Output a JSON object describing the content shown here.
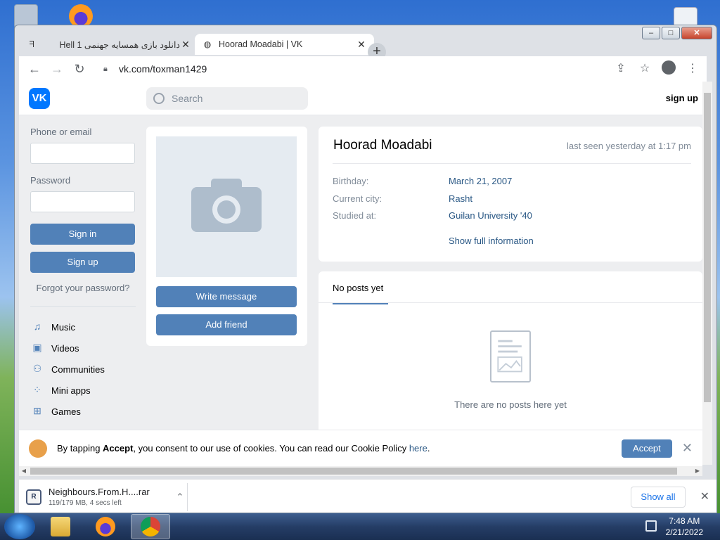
{
  "browser": {
    "tabs": [
      {
        "title": "دانلود بازی همسایه جهنمی Hell 1"
      },
      {
        "title": "Hoorad Moadabi | VK"
      }
    ],
    "url": "vk.com/toxman1429"
  },
  "vk": {
    "search_placeholder": "Search",
    "signup_link": "sign up",
    "login": {
      "phone_label": "Phone or email",
      "password_label": "Password",
      "signin_label": "Sign in",
      "signup_label": "Sign up",
      "forgot_label": "Forgot your password?"
    },
    "menu": [
      {
        "label": "Music",
        "icon": "music-icon"
      },
      {
        "label": "Videos",
        "icon": "video-icon"
      },
      {
        "label": "Communities",
        "icon": "communities-icon"
      },
      {
        "label": "Mini apps",
        "icon": "mini-apps-icon"
      },
      {
        "label": "Games",
        "icon": "gamepad-icon"
      }
    ],
    "profile": {
      "write_message": "Write message",
      "add_friend": "Add friend",
      "name": "Hoorad Moadabi",
      "last_seen": "last seen yesterday at 1:17 pm",
      "fields": [
        {
          "key": "Birthday:",
          "value": "March 21, 2007"
        },
        {
          "key": "Current city:",
          "value": "Rasht"
        },
        {
          "key": "Studied at:",
          "value": "Guilan University '40"
        }
      ],
      "show_full": "Show full information"
    },
    "posts": {
      "tab": "No posts yet",
      "empty": "There are no posts here yet"
    },
    "cookie": {
      "prefix": "By tapping ",
      "accept_bold": "Accept",
      "middle": ", you consent to our use of cookies. You can read our Cookie Policy ",
      "link": "here",
      "suffix": ".",
      "accept_button": "Accept"
    }
  },
  "downloads": {
    "file_name": "Neighbours.From.H....rar",
    "status": "119/179 MB, 4 secs left",
    "show_all": "Show all"
  },
  "taskbar": {
    "time": "7:48 AM",
    "date": "2/21/2022"
  },
  "colors": {
    "vk_blue": "#5181b8",
    "vk_logo": "#0077ff"
  }
}
